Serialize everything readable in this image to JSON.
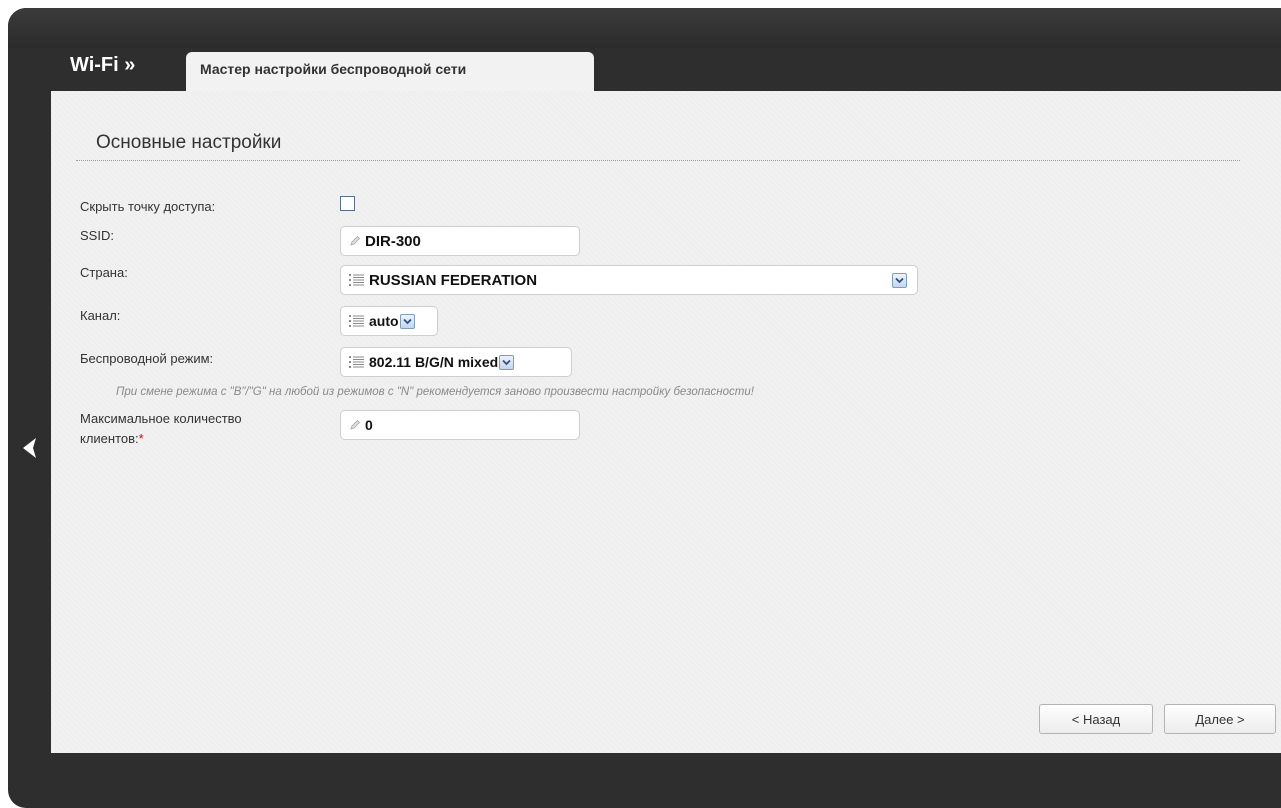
{
  "header": {
    "section_title": "Wi-Fi »",
    "active_tab": "Мастер настройки беспроводной сети"
  },
  "group": {
    "title": "Основные настройки"
  },
  "form": {
    "hide_ap_label": "Скрыть точку доступа:",
    "hide_ap_checked": false,
    "ssid_label": "SSID:",
    "ssid_value": "DIR-300",
    "country_label": "Страна:",
    "country_value": "RUSSIAN FEDERATION",
    "channel_label": "Канал:",
    "channel_value": "auto",
    "mode_label": "Беспроводной режим:",
    "mode_value": "802.11 B/G/N mixed",
    "mode_hint": "При смене режима с \"B\"/\"G\" на любой из режимов с \"N\" рекомендуется заново произвести настройку безопасности!",
    "max_clients_label_line1": "Максимальное количество",
    "max_clients_label_line2": "клиентов:",
    "max_clients_required_mark": "*",
    "max_clients_value": "0"
  },
  "buttons": {
    "back": "< Назад",
    "next": "Далее >"
  },
  "icons": {
    "back_nav": "chevron-left-icon",
    "text_field": "pencil-icon",
    "select_field": "list-icon",
    "dropdown": "chevron-down-icon"
  },
  "colors": {
    "frame": "#2e2e2e",
    "content_bg": "#f1f1f1",
    "required": "#e00000",
    "hint_text": "#8a8a8a"
  }
}
